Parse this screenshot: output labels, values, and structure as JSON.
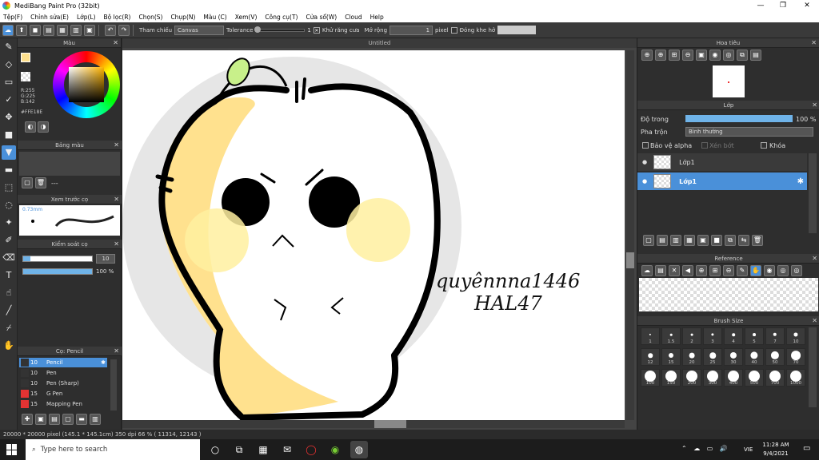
{
  "window": {
    "title": "MediBang Paint Pro (32bit)",
    "min": "—",
    "max": "❐",
    "close": "✕"
  },
  "menu": [
    "Tệp(F)",
    "Chỉnh sửa(E)",
    "Lớp(L)",
    "Bộ lọc(R)",
    "Chọn(S)",
    "Chụp(N)",
    "Màu (C)",
    "Xem(V)",
    "Công cụ(T)",
    "Cửa sổ(W)",
    "Cloud",
    "Help"
  ],
  "toolbar": {
    "ref_label": "Tham chiếu",
    "ref_value": "Canvas",
    "tolerance_label": "Tolerance",
    "tolerance_value": "1",
    "antialias_label": "Khử răng cưa",
    "expand_label": "Mở rộng",
    "expand_value": "1",
    "expand_unit": "pixel",
    "close_gap_label": "Đóng khe hở"
  },
  "color_panel": {
    "title": "Màu",
    "r": "R:255",
    "g": "G:225",
    "b": "B:142",
    "hex": "#FFE18E"
  },
  "palette_panel": {
    "title": "Bảng màu",
    "dash": "---"
  },
  "brush_preview": {
    "title": "Xem trước cọ",
    "size": "0.73mm"
  },
  "brush_control": {
    "title": "Kiểm soát cọ",
    "size_value": "10",
    "opacity_value": "100 %",
    "size_frac": 0.1,
    "opacity_frac": 1.0
  },
  "brush_list": {
    "title": "Cọ: Pencil",
    "items": [
      {
        "size": "10",
        "name": "Pencil",
        "color": "#333333"
      },
      {
        "size": "10",
        "name": "Pen",
        "color": "#333333"
      },
      {
        "size": "10",
        "name": "Pen (Sharp)",
        "color": "#333333"
      },
      {
        "size": "15",
        "name": "G Pen",
        "color": "#e33333"
      },
      {
        "size": "15",
        "name": "Mapping Pen",
        "color": "#e33333"
      }
    ]
  },
  "canvas_tab": "Untitled",
  "navigator": {
    "title": "Hoa tiêu"
  },
  "layer_panel": {
    "title": "Lớp",
    "opacity_label": "Độ trong",
    "opacity_value": "100 %",
    "blend_label": "Pha trộn",
    "blend_value": "Bình thường",
    "protect_alpha": "Bảo vệ alpha",
    "clipping": "Xén bớt",
    "lock": "Khóa",
    "layers": [
      {
        "name": "Lớp1"
      },
      {
        "name": "Lớp1"
      }
    ]
  },
  "reference_panel": {
    "title": "Reference"
  },
  "brush_size_panel": {
    "title": "Brush Size",
    "sizes": [
      "1",
      "1.5",
      "2",
      "3",
      "4",
      "5",
      "7",
      "10",
      "12",
      "15",
      "20",
      "25",
      "30",
      "40",
      "50",
      "70",
      "100",
      "150",
      "200",
      "300",
      "400",
      "500",
      "700",
      "1000"
    ]
  },
  "canvas_text": {
    "line1": "quyênnna1446",
    "line2": "HAL47"
  },
  "status": "20000 * 20000 pixel  (145.1 * 145.1cm)  350 dpi  66 %  ( 11314, 12143 )",
  "taskbar": {
    "search_placeholder": "Type here to search",
    "time": "11:28 AM",
    "date": "9/4/2021",
    "lang": "VIE"
  },
  "colors": {
    "accent": "#4a90d9",
    "fill": "#FFE18E",
    "cheek": "#fff0a0"
  }
}
